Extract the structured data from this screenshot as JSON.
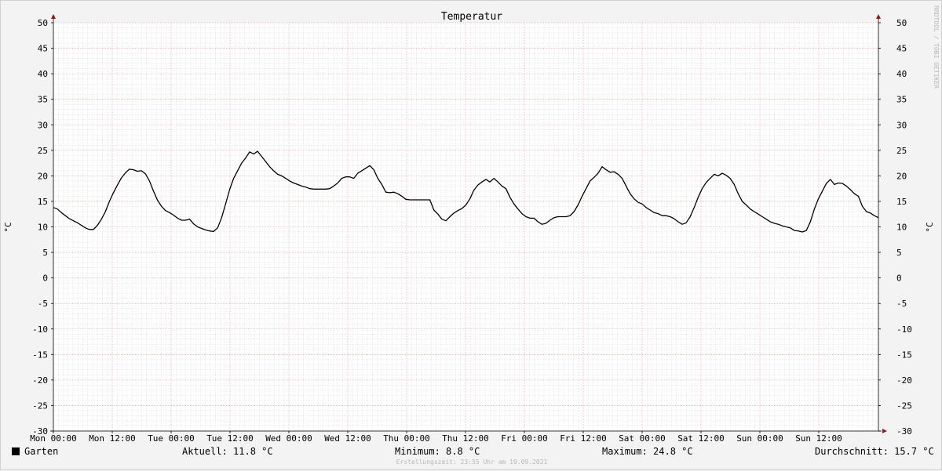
{
  "chart_data": {
    "type": "line",
    "title": "Temperatur",
    "ylabel": "°C",
    "ylim": [
      -30,
      50
    ],
    "y_ticks": [
      "50",
      "45",
      "40",
      "35",
      "30",
      "25",
      "20",
      "15",
      "10",
      "5",
      "0",
      "-5",
      "-10",
      "-15",
      "-20",
      "-25",
      "-30"
    ],
    "x_ticks": [
      "Mon 00:00",
      "Mon 12:00",
      "Tue 00:00",
      "Tue 12:00",
      "Wed 00:00",
      "Wed 12:00",
      "Thu 00:00",
      "Thu 12:00",
      "Fri 00:00",
      "Fri 12:00",
      "Sat 00:00",
      "Sat 12:00",
      "Sun 00:00",
      "Sun 12:00"
    ],
    "x_unit": "hours since Mon 00:00",
    "xlim": [
      0,
      175
    ],
    "grid": true,
    "series": [
      {
        "name": "Garten",
        "color": "#000000",
        "points": [
          [
            0,
            13.8
          ],
          [
            1,
            13.5
          ],
          [
            2,
            12.8
          ],
          [
            3,
            12.2
          ],
          [
            4,
            11.6
          ],
          [
            5,
            11.2
          ],
          [
            6,
            10.8
          ],
          [
            7,
            10.3
          ],
          [
            8,
            9.8
          ],
          [
            9,
            9.5
          ],
          [
            10,
            9.5
          ],
          [
            11,
            10.3
          ],
          [
            12,
            11.5
          ],
          [
            13,
            13
          ],
          [
            14,
            15
          ],
          [
            15,
            16.7
          ],
          [
            16,
            18.2
          ],
          [
            17,
            19.6
          ],
          [
            18,
            20.6
          ],
          [
            19,
            21.3
          ],
          [
            20,
            21.2
          ],
          [
            21,
            20.9
          ],
          [
            22,
            21
          ],
          [
            23,
            20.4
          ],
          [
            24,
            19
          ],
          [
            25,
            17
          ],
          [
            26,
            15.2
          ],
          [
            27,
            14
          ],
          [
            28,
            13.2
          ],
          [
            29,
            12.8
          ],
          [
            30,
            12.3
          ],
          [
            31,
            11.7
          ],
          [
            32,
            11.3
          ],
          [
            33,
            11.3
          ],
          [
            34,
            11.5
          ],
          [
            35,
            10.6
          ],
          [
            36,
            10
          ],
          [
            37,
            9.7
          ],
          [
            38,
            9.4
          ],
          [
            39,
            9.2
          ],
          [
            40,
            9.1
          ],
          [
            41,
            9.8
          ],
          [
            42,
            11.8
          ],
          [
            43,
            14.5
          ],
          [
            44,
            17.3
          ],
          [
            45,
            19.5
          ],
          [
            46,
            21
          ],
          [
            47,
            22.5
          ],
          [
            48,
            23.5
          ],
          [
            49,
            24.7
          ],
          [
            50,
            24.3
          ],
          [
            51,
            24.8
          ],
          [
            52,
            23.8
          ],
          [
            53,
            22.8
          ],
          [
            54,
            21.8
          ],
          [
            55,
            21
          ],
          [
            56,
            20.3
          ],
          [
            57,
            20
          ],
          [
            58,
            19.5
          ],
          [
            59,
            19
          ],
          [
            60,
            18.6
          ],
          [
            61,
            18.3
          ],
          [
            62,
            18
          ],
          [
            63,
            17.8
          ],
          [
            64,
            17.5
          ],
          [
            65,
            17.4
          ],
          [
            66,
            17.4
          ],
          [
            67,
            17.4
          ],
          [
            68,
            17.4
          ],
          [
            69,
            17.5
          ],
          [
            70,
            18
          ],
          [
            71,
            18.6
          ],
          [
            72,
            19.5
          ],
          [
            73,
            19.8
          ],
          [
            74,
            19.8
          ],
          [
            75,
            19.5
          ],
          [
            76,
            20.5
          ],
          [
            77,
            21
          ],
          [
            78,
            21.5
          ],
          [
            79,
            22
          ],
          [
            80,
            21.2
          ],
          [
            81,
            19.5
          ],
          [
            82,
            18.3
          ],
          [
            83,
            16.8
          ],
          [
            84,
            16.7
          ],
          [
            85,
            16.8
          ],
          [
            86,
            16.5
          ],
          [
            87,
            16
          ],
          [
            88,
            15.4
          ],
          [
            89,
            15.3
          ],
          [
            90,
            15.3
          ],
          [
            91,
            15.3
          ],
          [
            92,
            15.3
          ],
          [
            93,
            15.3
          ],
          [
            94,
            15.3
          ],
          [
            95,
            13.3
          ],
          [
            96,
            12.5
          ],
          [
            97,
            11.5
          ],
          [
            98,
            11.2
          ],
          [
            99,
            12
          ],
          [
            100,
            12.7
          ],
          [
            101,
            13.2
          ],
          [
            102,
            13.6
          ],
          [
            103,
            14.3
          ],
          [
            104,
            15.5
          ],
          [
            105,
            17.2
          ],
          [
            106,
            18.2
          ],
          [
            107,
            18.8
          ],
          [
            108,
            19.3
          ],
          [
            109,
            18.8
          ],
          [
            110,
            19.5
          ],
          [
            111,
            18.8
          ],
          [
            112,
            18
          ],
          [
            113,
            17.5
          ],
          [
            114,
            15.8
          ],
          [
            115,
            14.5
          ],
          [
            116,
            13.5
          ],
          [
            117,
            12.6
          ],
          [
            118,
            12
          ],
          [
            119,
            11.7
          ],
          [
            120,
            11.7
          ],
          [
            121,
            11
          ],
          [
            122,
            10.5
          ],
          [
            123,
            10.7
          ],
          [
            124,
            11.3
          ],
          [
            125,
            11.8
          ],
          [
            126,
            12
          ],
          [
            127,
            12
          ],
          [
            128,
            12
          ],
          [
            129,
            12.2
          ],
          [
            130,
            13
          ],
          [
            131,
            14.3
          ],
          [
            132,
            16
          ],
          [
            133,
            17.5
          ],
          [
            134,
            19
          ],
          [
            135,
            19.7
          ],
          [
            136,
            20.5
          ],
          [
            137,
            21.8
          ],
          [
            138,
            21.2
          ],
          [
            139,
            20.7
          ],
          [
            140,
            20.8
          ],
          [
            141,
            20.3
          ],
          [
            142,
            19.5
          ],
          [
            143,
            18
          ],
          [
            144,
            16.5
          ],
          [
            145,
            15.5
          ],
          [
            146,
            14.8
          ],
          [
            147,
            14.5
          ],
          [
            148,
            13.8
          ],
          [
            149,
            13.3
          ],
          [
            150,
            12.8
          ],
          [
            151,
            12.6
          ],
          [
            152,
            12.2
          ],
          [
            153,
            12.2
          ],
          [
            154,
            12
          ],
          [
            155,
            11.6
          ],
          [
            156,
            11
          ],
          [
            157,
            10.5
          ],
          [
            158,
            10.8
          ],
          [
            159,
            12
          ],
          [
            160,
            13.8
          ],
          [
            161,
            15.8
          ],
          [
            162,
            17.5
          ],
          [
            163,
            18.7
          ],
          [
            164,
            19.5
          ],
          [
            165,
            20.3
          ],
          [
            166,
            20
          ],
          [
            167,
            20.5
          ],
          [
            168,
            20.1
          ],
          [
            169,
            19.5
          ],
          [
            170,
            18.3
          ],
          [
            171,
            16.5
          ],
          [
            172,
            15
          ],
          [
            173,
            14.3
          ],
          [
            174,
            13.5
          ],
          [
            175,
            13
          ],
          [
            176,
            12.5
          ],
          [
            177,
            12
          ],
          [
            178,
            11.5
          ],
          [
            179,
            11
          ],
          [
            180,
            10.7
          ],
          [
            181,
            10.5
          ],
          [
            182,
            10.2
          ],
          [
            183,
            10
          ],
          [
            184,
            9.8
          ],
          [
            185,
            9.3
          ],
          [
            186,
            9.2
          ],
          [
            187,
            9
          ],
          [
            188,
            9.3
          ],
          [
            189,
            11
          ],
          [
            190,
            13.5
          ],
          [
            191,
            15.5
          ],
          [
            192,
            17
          ],
          [
            193,
            18.5
          ],
          [
            194,
            19.3
          ],
          [
            195,
            18.3
          ],
          [
            196,
            18.6
          ],
          [
            197,
            18.5
          ],
          [
            198,
            18
          ],
          [
            199,
            17.3
          ],
          [
            200,
            16.5
          ],
          [
            201,
            16
          ],
          [
            202,
            14
          ],
          [
            203,
            13
          ],
          [
            204,
            12.7
          ],
          [
            205,
            12.2
          ],
          [
            206,
            11.8
          ]
        ]
      }
    ]
  },
  "legend": {
    "series_name": "Garten",
    "aktuell": "Aktuell: 11.8 °C",
    "minimum": "Minimum: 8.8 °C",
    "maximum": "Maximum: 24.8 °C",
    "durchschnitt": "Durchschnitt: 15.7 °C"
  },
  "watermark": "RRDTOOL / TOBI OETIKER",
  "footer": "Erstellungszeit: 23:55 Uhr am 19.09.2021"
}
